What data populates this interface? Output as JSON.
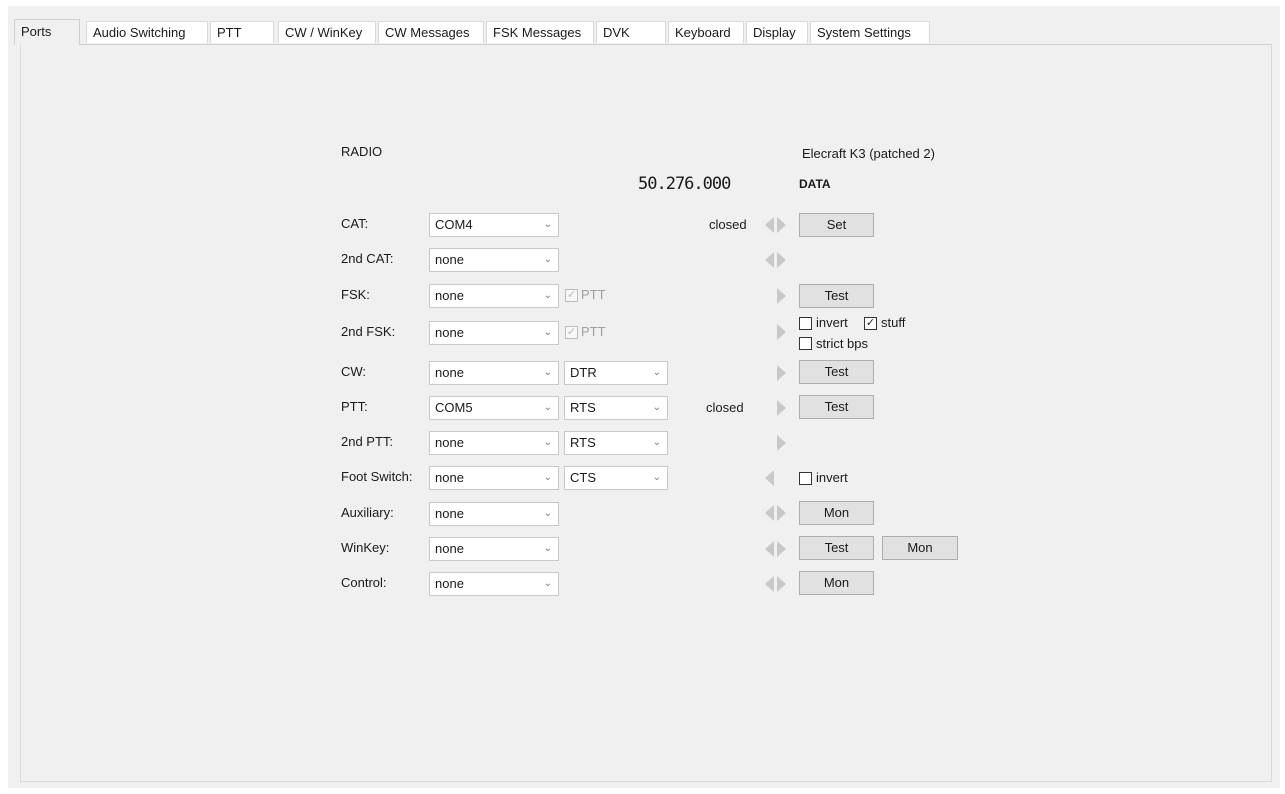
{
  "tabs": [
    {
      "label": "Ports",
      "active": true
    },
    {
      "label": "Audio Switching"
    },
    {
      "label": "PTT"
    },
    {
      "label": "CW / WinKey"
    },
    {
      "label": "CW Messages"
    },
    {
      "label": "FSK Messages"
    },
    {
      "label": "DVK"
    },
    {
      "label": "Keyboard"
    },
    {
      "label": "Display"
    },
    {
      "label": "System Settings"
    }
  ],
  "radio": {
    "header": "RADIO",
    "model": "Elecraft K3 (patched 2)",
    "frequency": "50.276.000",
    "mode": "DATA"
  },
  "rows": {
    "cat": {
      "label": "CAT:",
      "port": "COM4",
      "status": "closed",
      "button": "Set"
    },
    "cat2": {
      "label": "2nd CAT:",
      "port": "none"
    },
    "fsk": {
      "label": "FSK:",
      "port": "none",
      "ptt_label": "PTT",
      "button": "Test"
    },
    "fsk2": {
      "label": "2nd FSK:",
      "port": "none",
      "ptt_label": "PTT",
      "invert_label": "invert",
      "stuff_label": "stuff",
      "strict_label": "strict bps"
    },
    "cw": {
      "label": "CW:",
      "port": "none",
      "line": "DTR",
      "button": "Test"
    },
    "ptt": {
      "label": "PTT:",
      "port": "COM5",
      "line": "RTS",
      "status": "closed",
      "button": "Test"
    },
    "ptt2": {
      "label": "2nd PTT:",
      "port": "none",
      "line": "RTS"
    },
    "foot": {
      "label": "Foot Switch:",
      "port": "none",
      "line": "CTS",
      "invert_label": "invert"
    },
    "aux": {
      "label": "Auxiliary:",
      "port": "none",
      "button": "Mon"
    },
    "winkey": {
      "label": "WinKey:",
      "port": "none",
      "button_test": "Test",
      "button_mon": "Mon"
    },
    "control": {
      "label": "Control:",
      "port": "none",
      "button": "Mon"
    }
  },
  "checks": {
    "fsk_ptt": true,
    "fsk2_ptt": true,
    "fsk2_invert": false,
    "fsk2_stuff": true,
    "fsk2_strict": false,
    "foot_invert": false
  },
  "icons": {
    "combo_arrow": "chevron-down-icon",
    "port_arrows": "port-direction-arrows-icon",
    "check": "check-icon"
  },
  "colors": {
    "window_bg": "#f0f0f0",
    "button_bg": "#e1e1e1",
    "indicator_grey": "#c8c8c8"
  }
}
